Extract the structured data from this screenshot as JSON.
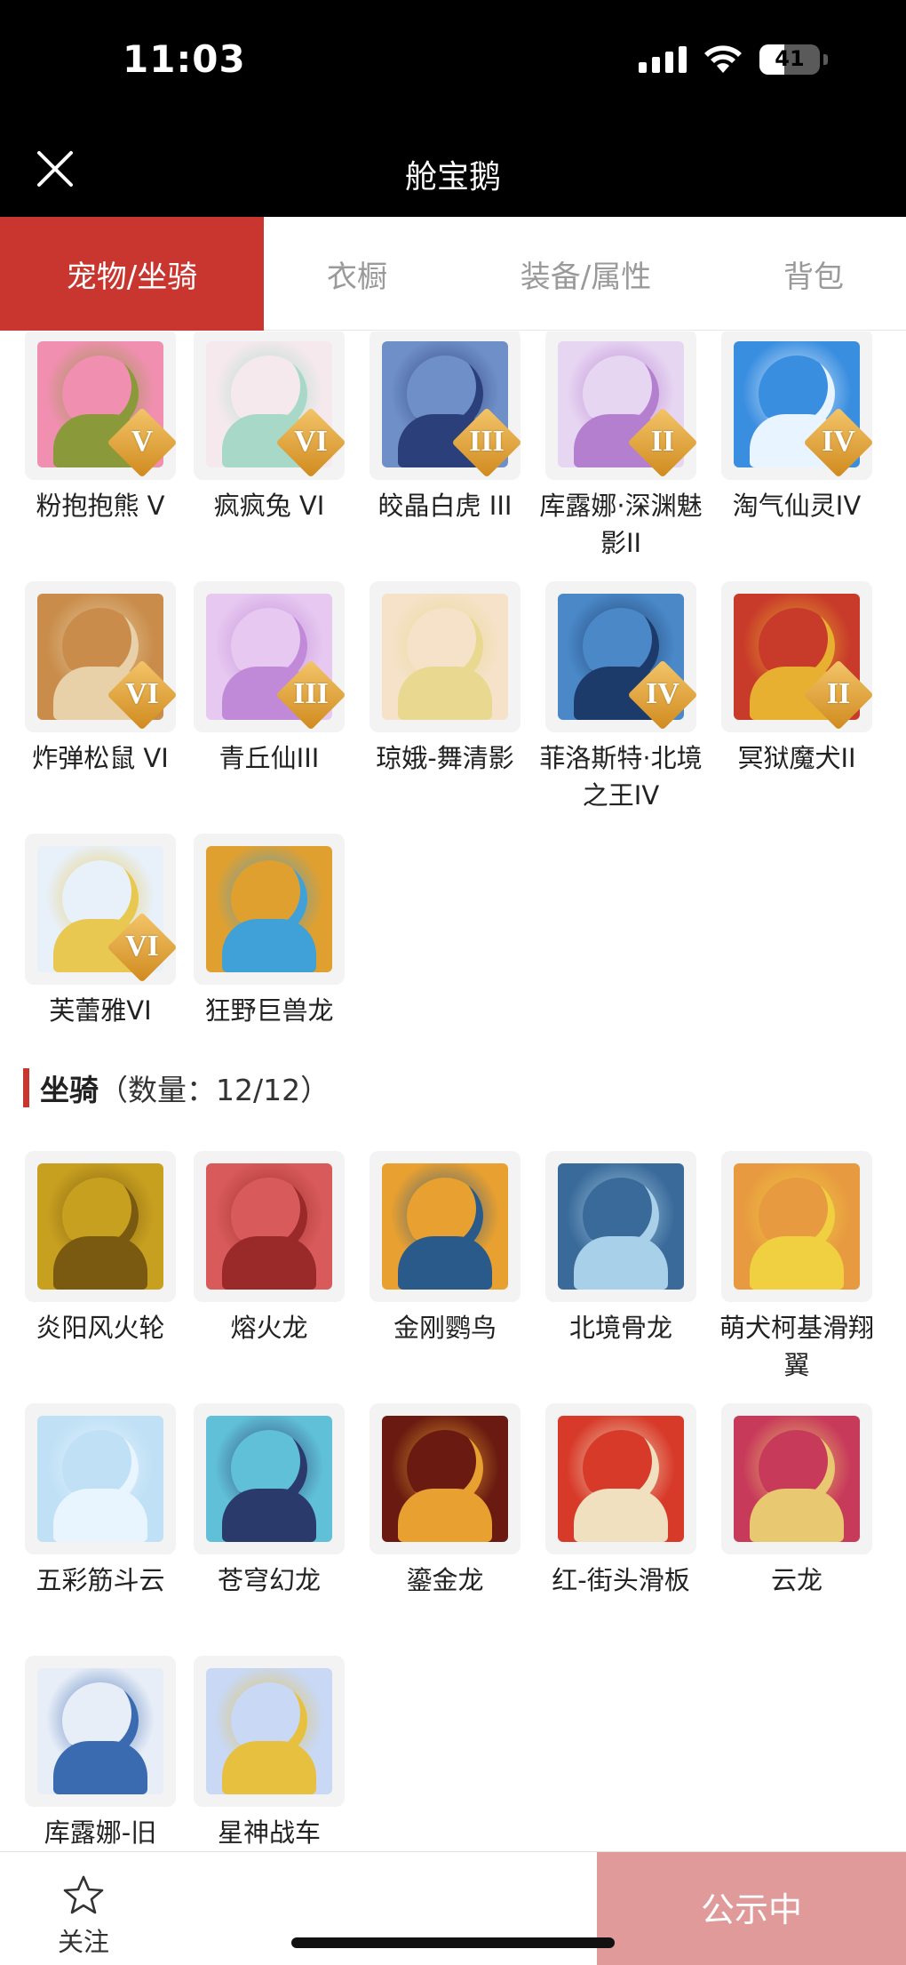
{
  "status_bar": {
    "time": "11:03",
    "battery": "41",
    "battery_level": 0.41
  },
  "header": {
    "title": "舱宝鹅"
  },
  "tabs": [
    {
      "label": "宠物/坐骑",
      "active": true
    },
    {
      "label": "衣橱",
      "active": false
    },
    {
      "label": "装备/属性",
      "active": false
    },
    {
      "label": "背包",
      "active": false
    }
  ],
  "pets": [
    {
      "label": "粉抱抱熊 V",
      "rank": "V",
      "icon": "pink-bear",
      "color": "#f08fb0",
      "accent": "#8a9a3a"
    },
    {
      "label": "疯疯兔 VI",
      "rank": "VI",
      "icon": "white-rabbit",
      "color": "#f6e9ee",
      "accent": "#a8d8c8"
    },
    {
      "label": "皎晶白虎 III",
      "rank": "III",
      "icon": "white-tiger",
      "color": "#6f8fc8",
      "accent": "#2b3f7a"
    },
    {
      "label": "库露娜·深渊魅影II",
      "rank": "II",
      "icon": "kuluna-girl",
      "color": "#e7d6f2",
      "accent": "#b57fd0"
    },
    {
      "label": "淘气仙灵IV",
      "rank": "IV",
      "icon": "blue-dog",
      "color": "#3a8ee0",
      "accent": "#e8f4ff"
    },
    {
      "label": "炸弹松鼠 VI",
      "rank": "VI",
      "icon": "squirrel",
      "color": "#c98c4a",
      "accent": "#e8d0a8"
    },
    {
      "label": "青丘仙III",
      "rank": "III",
      "icon": "fox-fairy",
      "color": "#e6c8f0",
      "accent": "#c08ad8"
    },
    {
      "label": "琼娥-舞清影",
      "rank": "",
      "icon": "dancer-girl",
      "color": "#f5e2c8",
      "accent": "#e8d890"
    },
    {
      "label": "菲洛斯特·北境之王IV",
      "rank": "IV",
      "icon": "ice-king",
      "color": "#4a88c8",
      "accent": "#1c3a6a"
    },
    {
      "label": "冥狱魔犬II",
      "rank": "II",
      "icon": "hell-hound",
      "color": "#c83a2a",
      "accent": "#e8b030"
    },
    {
      "label": "芙蕾雅VI",
      "rank": "VI",
      "icon": "freya",
      "color": "#e8f0fa",
      "accent": "#e8c850"
    },
    {
      "label": "狂野巨兽龙",
      "rank": "",
      "icon": "wild-dragon",
      "color": "#e0a030",
      "accent": "#40a0d8"
    }
  ],
  "mounts_section": {
    "title": "坐骑",
    "count": "（数量：12/12）"
  },
  "mounts": [
    {
      "label": "炎阳风火轮",
      "icon": "fire-wheel",
      "color": "#c8a020",
      "accent": "#7a5a10"
    },
    {
      "label": "熔火龙",
      "icon": "lava-dragon",
      "color": "#d85a5a",
      "accent": "#9a2a2a"
    },
    {
      "label": "金刚鹦鸟",
      "icon": "parrot",
      "color": "#e8a030",
      "accent": "#2a5a8a"
    },
    {
      "label": "北境骨龙",
      "icon": "bone-dragon",
      "color": "#3a6a9a",
      "accent": "#a8d0e8"
    },
    {
      "label": "萌犬柯基滑翔翼",
      "icon": "corgi-glider",
      "color": "#e89a40",
      "accent": "#f0d040"
    },
    {
      "label": "五彩筋斗云",
      "icon": "cloud",
      "color": "#bfe0f5",
      "accent": "#e8f5ff"
    },
    {
      "label": "苍穹幻龙",
      "icon": "sky-dragon",
      "color": "#60c0d8",
      "accent": "#2a3a6a"
    },
    {
      "label": "鎏金龙",
      "icon": "gold-dragon",
      "color": "#6a1a10",
      "accent": "#e8a030"
    },
    {
      "label": "红-街头滑板",
      "icon": "skateboard",
      "color": "#d83a2a",
      "accent": "#f0e0c0"
    },
    {
      "label": "云龙",
      "icon": "cloud-dragon",
      "color": "#c83a5a",
      "accent": "#e8c870"
    },
    {
      "label": "库露娜-旧",
      "icon": "kuluna-old",
      "color": "#e8eef8",
      "accent": "#3a6ab0"
    },
    {
      "label": "星神战车",
      "icon": "star-chariot",
      "color": "#c8d8f5",
      "accent": "#e8c040"
    }
  ],
  "bottom_bar": {
    "follow_label": "关注",
    "public_label": "公示中"
  },
  "colors": {
    "accent_red": "#c9352f",
    "public_button": "#e09a9a"
  }
}
